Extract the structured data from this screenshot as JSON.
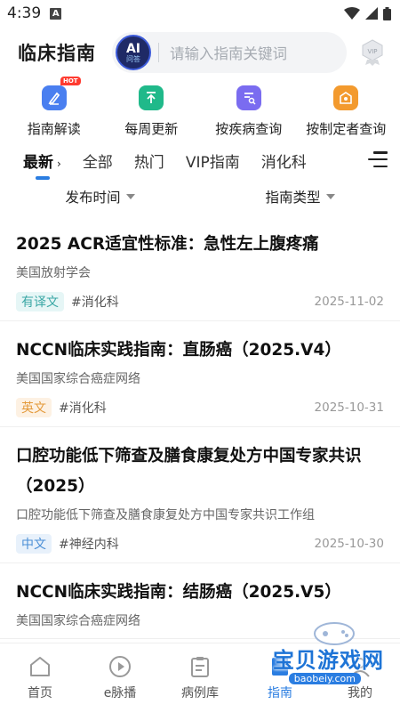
{
  "status_bar": {
    "time": "4:39",
    "notif": "A"
  },
  "header": {
    "title": "临床指南",
    "ai_top": "AI",
    "ai_bottom": "问答",
    "search_placeholder": "请输入指南关键词",
    "vip": "VIP"
  },
  "quick": [
    {
      "label": "指南解读",
      "icon": "book-pen-icon",
      "color": "#4a7ff0",
      "badge": "HOT"
    },
    {
      "label": "每周更新",
      "icon": "upload-icon",
      "color": "#20b98a"
    },
    {
      "label": "按疾病查询",
      "icon": "doc-search-icon",
      "color": "#7a6cf0"
    },
    {
      "label": "按制定者查询",
      "icon": "org-icon",
      "color": "#f39a2e"
    }
  ],
  "tabs": [
    "最新",
    "全部",
    "热门",
    "VIP指南",
    "消化科"
  ],
  "tab_caret": "›",
  "filters": {
    "time": "发布时间",
    "type": "指南类型"
  },
  "articles": [
    {
      "title": "2025 ACR适宜性标准：急性左上腹疼痛",
      "source": "美国放射学会",
      "lang": "有译文",
      "dept": "#消化科",
      "date": "2025-11-02"
    },
    {
      "title": "NCCN临床实践指南：直肠癌（2025.V4）",
      "source": "美国国家综合癌症网络",
      "lang": "英文",
      "dept": "#消化科",
      "date": "2025-10-31"
    },
    {
      "title": "口腔功能低下筛查及膳食康复处方中国专家共识（2025）",
      "source": "口腔功能低下筛查及膳食康复处方中国专家共识工作组",
      "lang": "中文",
      "dept": "#神经内科",
      "date": "2025-10-30"
    },
    {
      "title": "NCCN临床实践指南：结肠癌（2025.V5）",
      "source": "美国国家综合癌症网络",
      "lang": "",
      "dept": "",
      "date": ""
    }
  ],
  "nav": [
    "首页",
    "e脉播",
    "病例库",
    "指南",
    "我的"
  ],
  "watermark": {
    "title": "宝贝游戏网",
    "url": "baobeiy.com"
  },
  "colors": {
    "accent": "#2a7de1"
  }
}
